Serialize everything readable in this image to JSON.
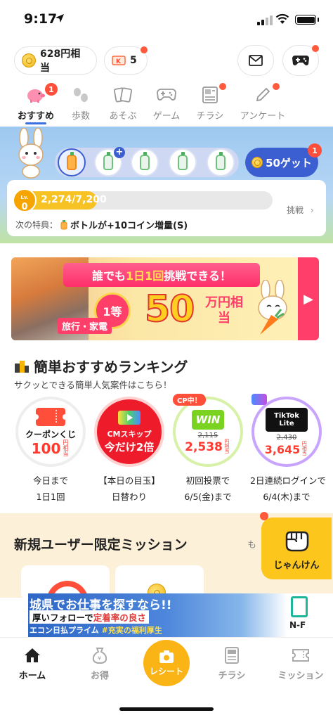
{
  "status": {
    "time": "9:17"
  },
  "topbar": {
    "coins": "628円相当",
    "tickets": "5"
  },
  "tabs": [
    {
      "label": "おすすめ",
      "badge": "1"
    },
    {
      "label": "歩数"
    },
    {
      "label": "あそぶ"
    },
    {
      "label": "ゲーム"
    },
    {
      "label": "チラシ"
    },
    {
      "label": "アンケート"
    }
  ],
  "hero": {
    "get_label": "50ゲット",
    "get_badge": "1",
    "level_prefix": "Lv.",
    "level": "0",
    "progress_text": "2,274/7,200",
    "progress": 0.316,
    "challenge": "挑戦",
    "next_label": "次の特典：",
    "next_value": "ボトルが+10コイン増量(S)"
  },
  "banner": {
    "ribbon_a": "誰でも",
    "ribbon_b": "1日1回",
    "ribbon_c": "挑戦できる！",
    "rank": "1等",
    "category": "旅行・家電",
    "amount": "50",
    "unit": "万円相当"
  },
  "ranking": {
    "title": "簡単おすすめランキング",
    "subtitle": "サクッとできる簡単人気案件はこちら！",
    "items": [
      {
        "name": "クーポンくじ",
        "value": "100",
        "unit": "円相当",
        "cap1": "今日まで",
        "cap2": "1日1回"
      },
      {
        "name": "CMスキップ",
        "value": "今だけ2倍",
        "cap1": "【本日の目玉】",
        "cap2": "日替わり"
      },
      {
        "name": "WIN",
        "tag": "CP中！",
        "old": "2,115",
        "value": "2,538",
        "unit": "円相当",
        "cap1": "初回投票で",
        "cap2": "6/5(金)まで"
      },
      {
        "name": "TikTok Lite",
        "old": "2,430",
        "value": "3,645",
        "unit": "円相当",
        "cap1": "2日連続ログインで",
        "cap2": "6/4(木)まで"
      }
    ]
  },
  "mission": {
    "title": "新規ユーザー限定ミッション",
    "more": "も"
  },
  "janken": {
    "label": "じゃんけん"
  },
  "ad": {
    "line1": "城県でお仕事を探すなら!!",
    "line2a": "厚いフォローで",
    "line2b": "定着率の良さ",
    "line3a": "エコン日払プライム",
    "line3b": "#充実の福利厚生",
    "brand": "N-F"
  },
  "nav": [
    {
      "label": "ホーム"
    },
    {
      "label": "お得"
    },
    {
      "label": "レシート"
    },
    {
      "label": "チラシ"
    },
    {
      "label": "ミッション"
    }
  ],
  "colors": {
    "accent": "#3b5fd0",
    "coin": "#f1b612",
    "receipt": "#fbb416",
    "badge": "#ff4f3a"
  }
}
